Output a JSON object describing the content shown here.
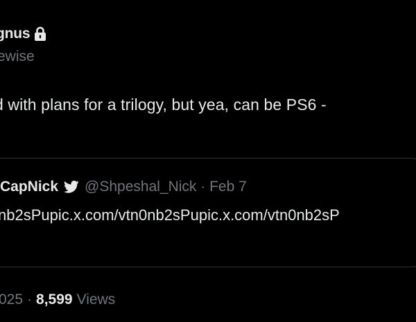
{
  "tweet": {
    "author_name": "gnus",
    "author_handle": "ewise",
    "text": "d with plans for a trilogy, but yea, can be PS6 -"
  },
  "quote": {
    "author_name": "CapNick",
    "author_handle_date": "@Shpeshal_Nick · Feb 7",
    "text": "nb2sPupic.x.com/vtn0nb2sPupic.x.com/vtn0nb2sP"
  },
  "meta": {
    "date": "025",
    "separator": "·",
    "views_count": "8,599",
    "views_label": "Views"
  },
  "icons": {
    "protected": "lock-icon",
    "verified": "bird-icon"
  },
  "colors": {
    "background": "#000000",
    "text_primary": "#e7e9ea",
    "text_secondary": "#71767b",
    "border": "#2f3336",
    "link_blue": "#1d9bf0"
  }
}
